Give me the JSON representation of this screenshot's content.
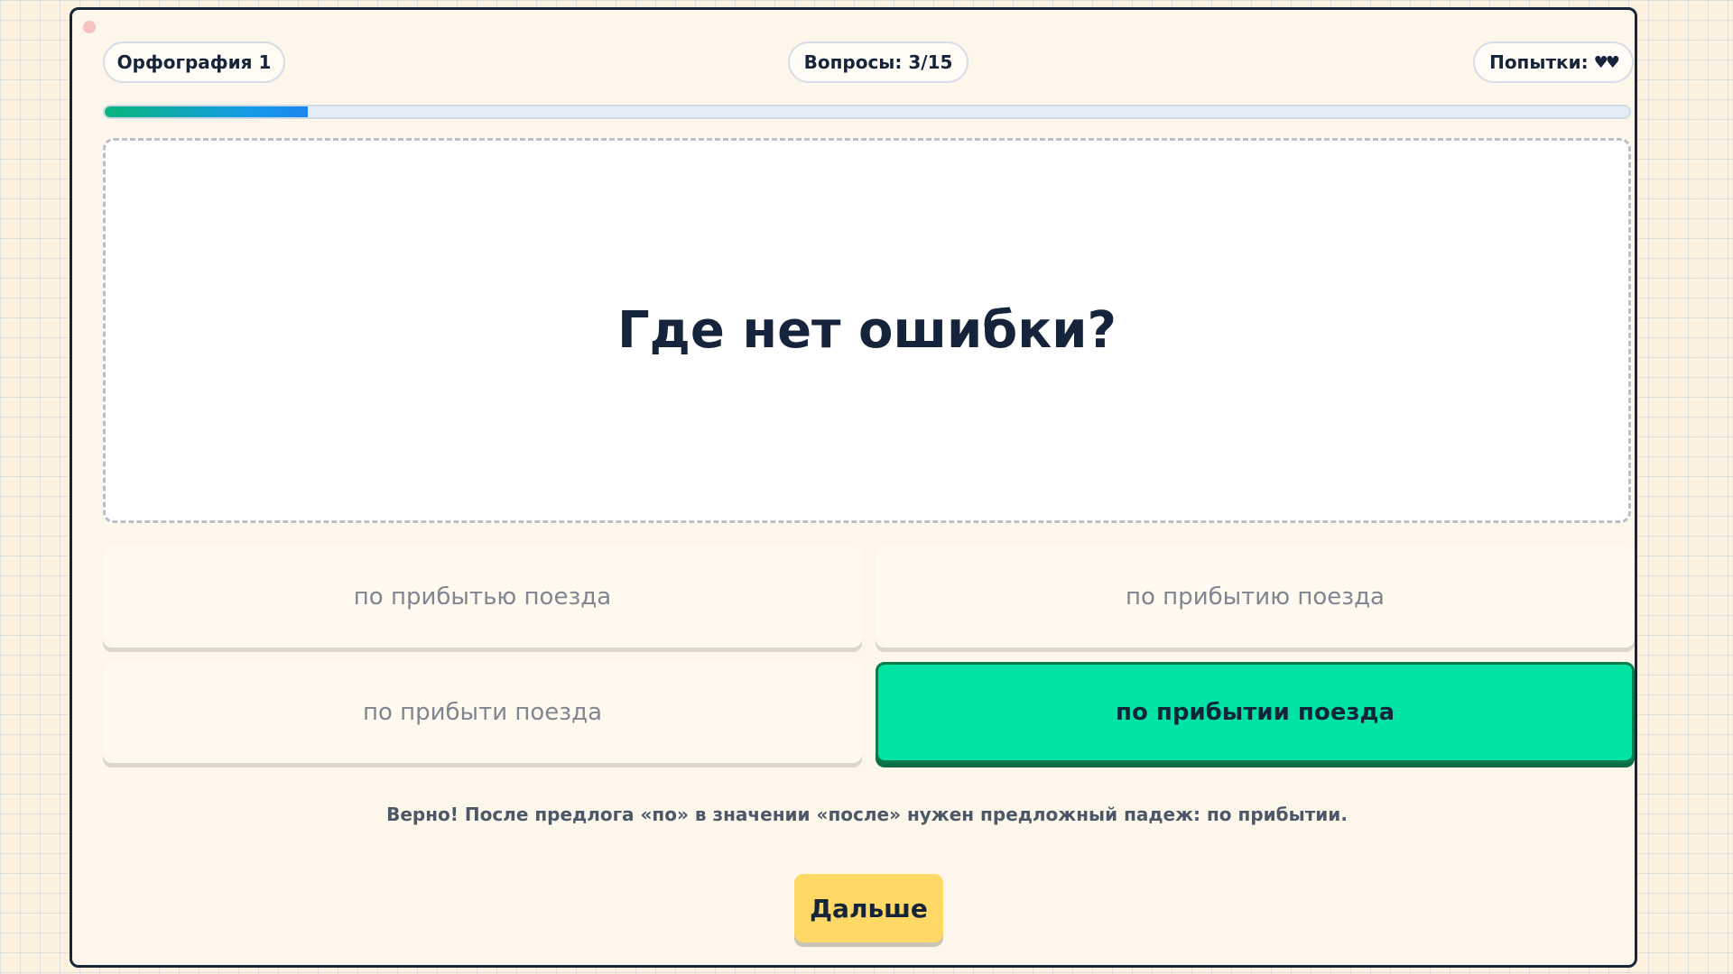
{
  "header": {
    "level_label": "Орфография 1",
    "questions_label": "Вопросы: 3/15",
    "attempts_label": "Попытки:",
    "attempts_hearts": "♥♥",
    "attempts_remaining": 2
  },
  "progress": {
    "fraction": 0.133,
    "colors": [
      "#0ab57a",
      "#1e86ee"
    ]
  },
  "question": {
    "text": "Где нет ошибки?"
  },
  "options": [
    {
      "label": "по прибытью поезда",
      "state": "default"
    },
    {
      "label": "по прибытию поезда",
      "state": "default"
    },
    {
      "label": "по прибыти поезда",
      "state": "default"
    },
    {
      "label": "по прибытии поезда",
      "state": "correct"
    }
  ],
  "feedback": {
    "text": "Верно! После предлога «по» в значении «после» нужен предложный падеж: по прибытии."
  },
  "next_button": {
    "label": "Дальше"
  },
  "colors": {
    "background": "#fbf1de",
    "correct": "#00e3a4",
    "button": "#ffd866",
    "text": "#15243a"
  }
}
